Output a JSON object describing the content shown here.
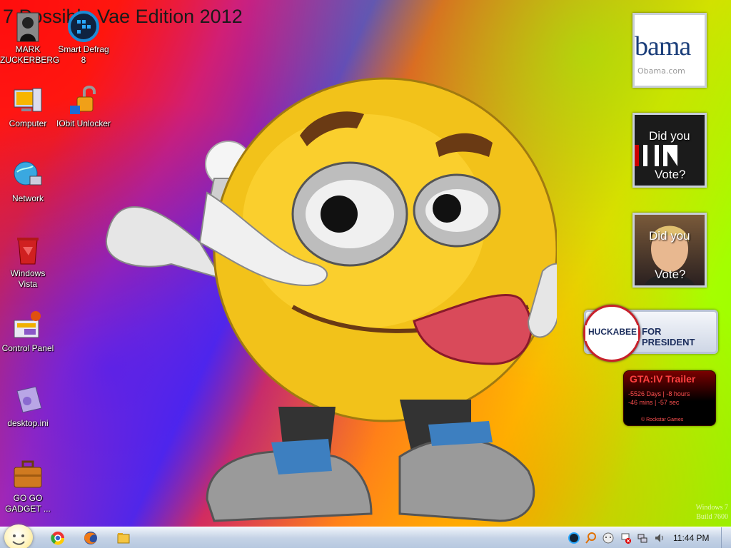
{
  "desktop": {
    "title": "7 Possible Vae Edition 2012",
    "icons": [
      {
        "label": "MARK ZUCKERBERG"
      },
      {
        "label": "Smart Defrag 8"
      },
      {
        "label": "Computer"
      },
      {
        "label": "IObit Unlocker"
      },
      {
        "label": "Network"
      },
      {
        "label": "Windows Vista"
      },
      {
        "label": "Control Panel"
      },
      {
        "label": "desktop.ini"
      },
      {
        "label": "GO GO GADGET ..."
      }
    ],
    "watermark": {
      "line1": "Windows 7",
      "line2": "Build 7600"
    }
  },
  "gadgets": {
    "obama": {
      "logo": "bama",
      "url": "Obama.com"
    },
    "vote1": {
      "line1": "Did you",
      "line2": "Vote?"
    },
    "vote2": {
      "line1": "Did you",
      "line2": "Vote?"
    },
    "huckabee": {
      "name": "HUCKABEE",
      "tagline": "FOR PRESIDENT"
    },
    "gta": {
      "title": "GTA:IV Trailer",
      "line1": "-5526 Days | -8 hours",
      "line2": "-46 mins | -57 sec",
      "credit": "© Rockstar Games"
    }
  },
  "taskbar": {
    "clock": "11:44 PM"
  }
}
